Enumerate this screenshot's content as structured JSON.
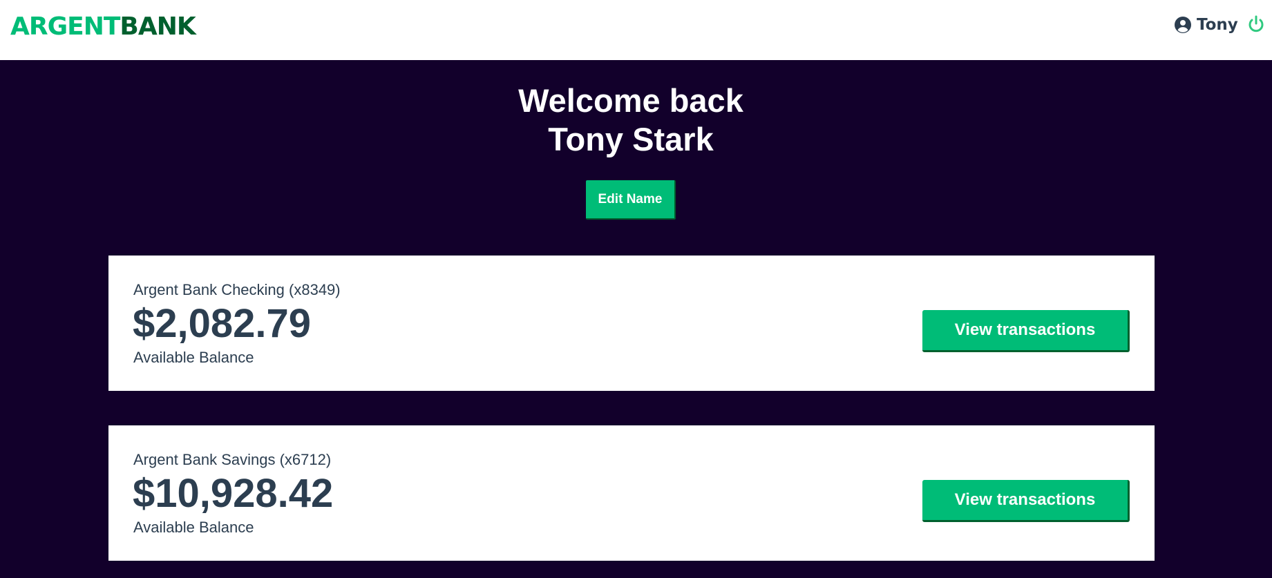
{
  "header": {
    "logo_part1": "ARGENT",
    "logo_part2": "BANK",
    "user_name": "Tony",
    "icons": [
      "user-circle-icon",
      "power-icon"
    ]
  },
  "hero": {
    "line1": "Welcome back",
    "line2": "Tony Stark",
    "edit_label": "Edit Name"
  },
  "accounts": [
    {
      "title": "Argent Bank Checking (x8349)",
      "amount": "$2,082.79",
      "description": "Available Balance",
      "button": "View transactions"
    },
    {
      "title": "Argent Bank Savings (x6712)",
      "amount": "$10,928.42",
      "description": "Available Balance",
      "button": "View transactions"
    }
  ],
  "colors": {
    "brand": "#00bc77",
    "brand_dark": "#00602e",
    "background": "#12002b",
    "text": "#2c3e50"
  }
}
